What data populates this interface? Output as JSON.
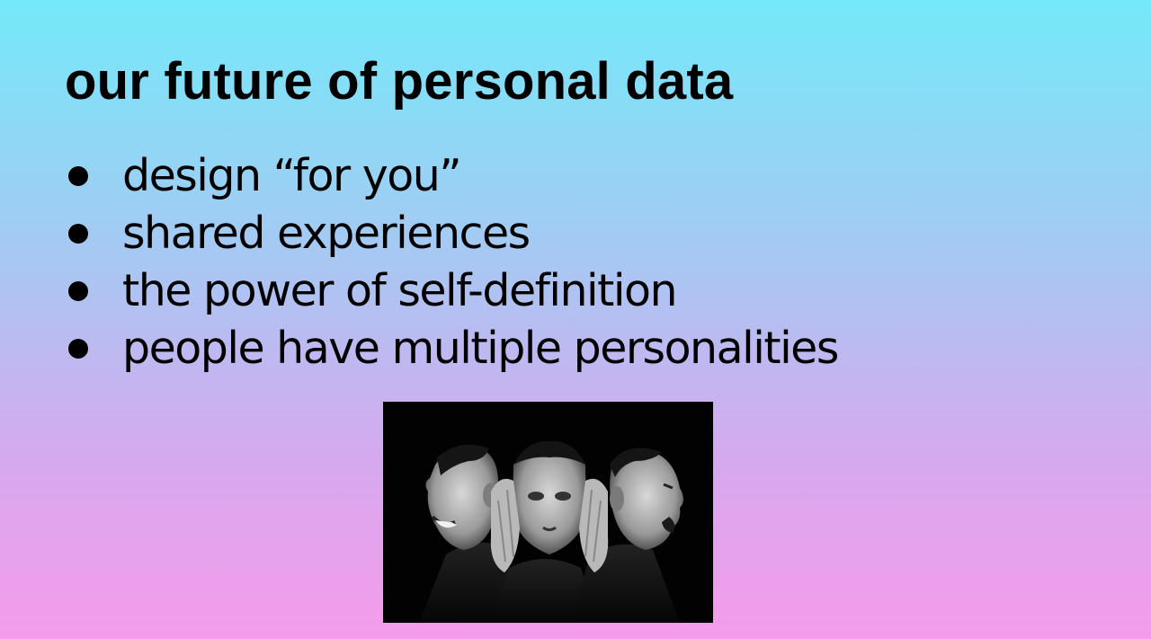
{
  "slide": {
    "title": "our future of personal data",
    "bullets": [
      "design “for you”",
      "shared experiences",
      "the power of self-definition",
      "people have multiple personalities"
    ],
    "image": {
      "subject": "three faces: laughing profile, hands-on-head center face, shouting profile",
      "style": "black-and-white photo"
    }
  },
  "colors": {
    "gradient_top": "#74e9f9",
    "gradient_bottom": "#f59ceb",
    "text": "#000000"
  }
}
